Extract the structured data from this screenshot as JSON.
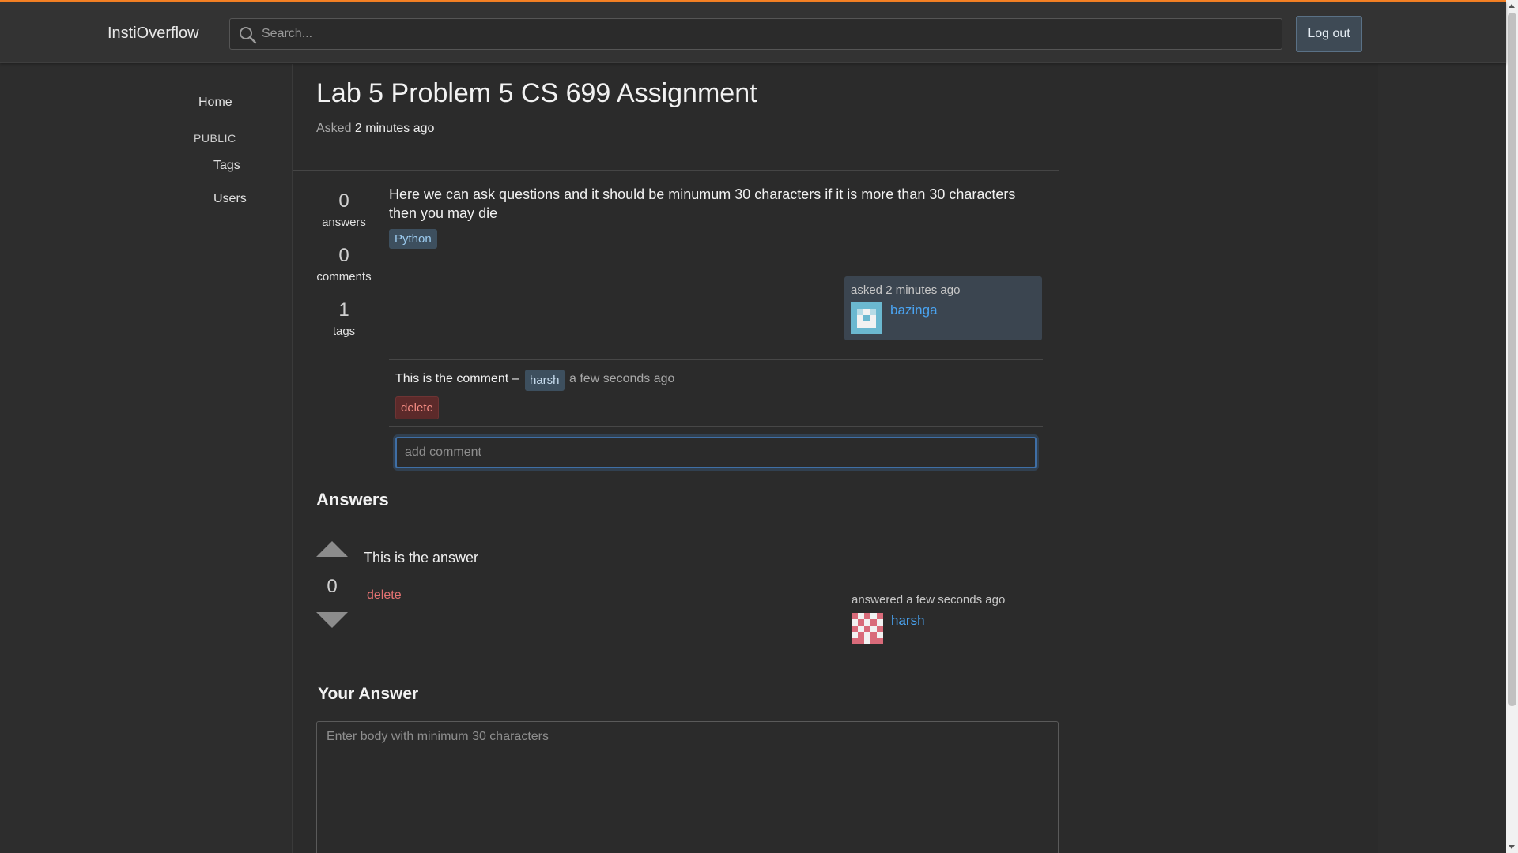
{
  "header": {
    "app_title": "InstiOverflow",
    "search_placeholder": "Search...",
    "logout_label": "Log out",
    "accent_color": "#f48024"
  },
  "sidebar": {
    "home": "Home",
    "section_label": "PUBLIC",
    "tags": "Tags",
    "users": "Users"
  },
  "question": {
    "title": "Lab 5 Problem 5 CS 699 Assignment",
    "asked_label": "Asked",
    "asked_time": "2 minutes ago",
    "stats": [
      {
        "value": "0",
        "label": "answers"
      },
      {
        "value": "0",
        "label": "comments"
      },
      {
        "value": "1",
        "label": "tags"
      }
    ],
    "body": "Here we can ask questions and it should be minumum 30 characters if it is more than 30 characters then you may die",
    "tag": "Python",
    "asker": {
      "time_text": "asked 2 minutes ago",
      "username": "bazinga",
      "avatar_icon": "identicon-avatar"
    }
  },
  "comment": {
    "text": "This is the comment –",
    "user": "harsh",
    "time": "a few seconds ago",
    "delete_label": "delete",
    "input_placeholder": "add comment"
  },
  "answers": {
    "heading": "Answers",
    "items": [
      {
        "votes": "0",
        "body": "This is the answer",
        "delete_label": "delete",
        "answered_text": "answered a few seconds ago",
        "username": "harsh",
        "avatar_icon": "identicon-avatar"
      }
    ]
  },
  "your_answer": {
    "heading": "Your Answer",
    "placeholder": "Enter body with minimum 30 characters"
  }
}
